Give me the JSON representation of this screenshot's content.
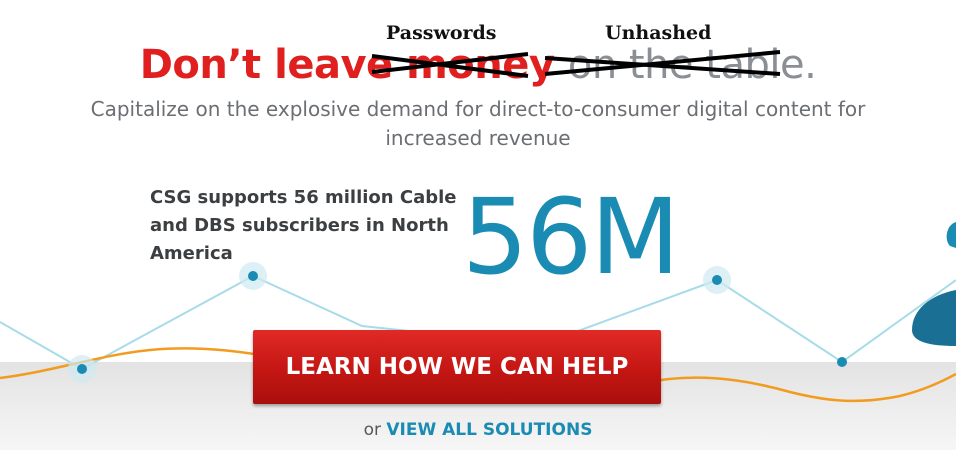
{
  "headline": {
    "prefix": "Don’t leave",
    "struck_word": "money",
    "trailing": "on the table",
    "period": "."
  },
  "annotations": {
    "replacement_1": "Passwords",
    "replacement_2": "Unhashed"
  },
  "subtitle": "Capitalize on the explosive demand for direct-to-consumer digital content for increased revenue",
  "stat": {
    "text": "CSG supports 56 million Cable and DBS subscribers in North America",
    "number": "56M"
  },
  "cta": {
    "label": "LEARN HOW WE CAN HELP"
  },
  "footer": {
    "prefix": "or",
    "link_label": "VIEW ALL SOLUTIONS"
  },
  "colors": {
    "headline_red": "#e01f1f",
    "accent_blue": "#1a8cb3",
    "cta_red": "#c41613",
    "trend_line_light": "#a7dbe8",
    "trend_line_orange": "#f29c1f",
    "floor_grey": "#dcdcdc"
  },
  "icons": {
    "decorative_figure": "person-silhouette-icon"
  }
}
